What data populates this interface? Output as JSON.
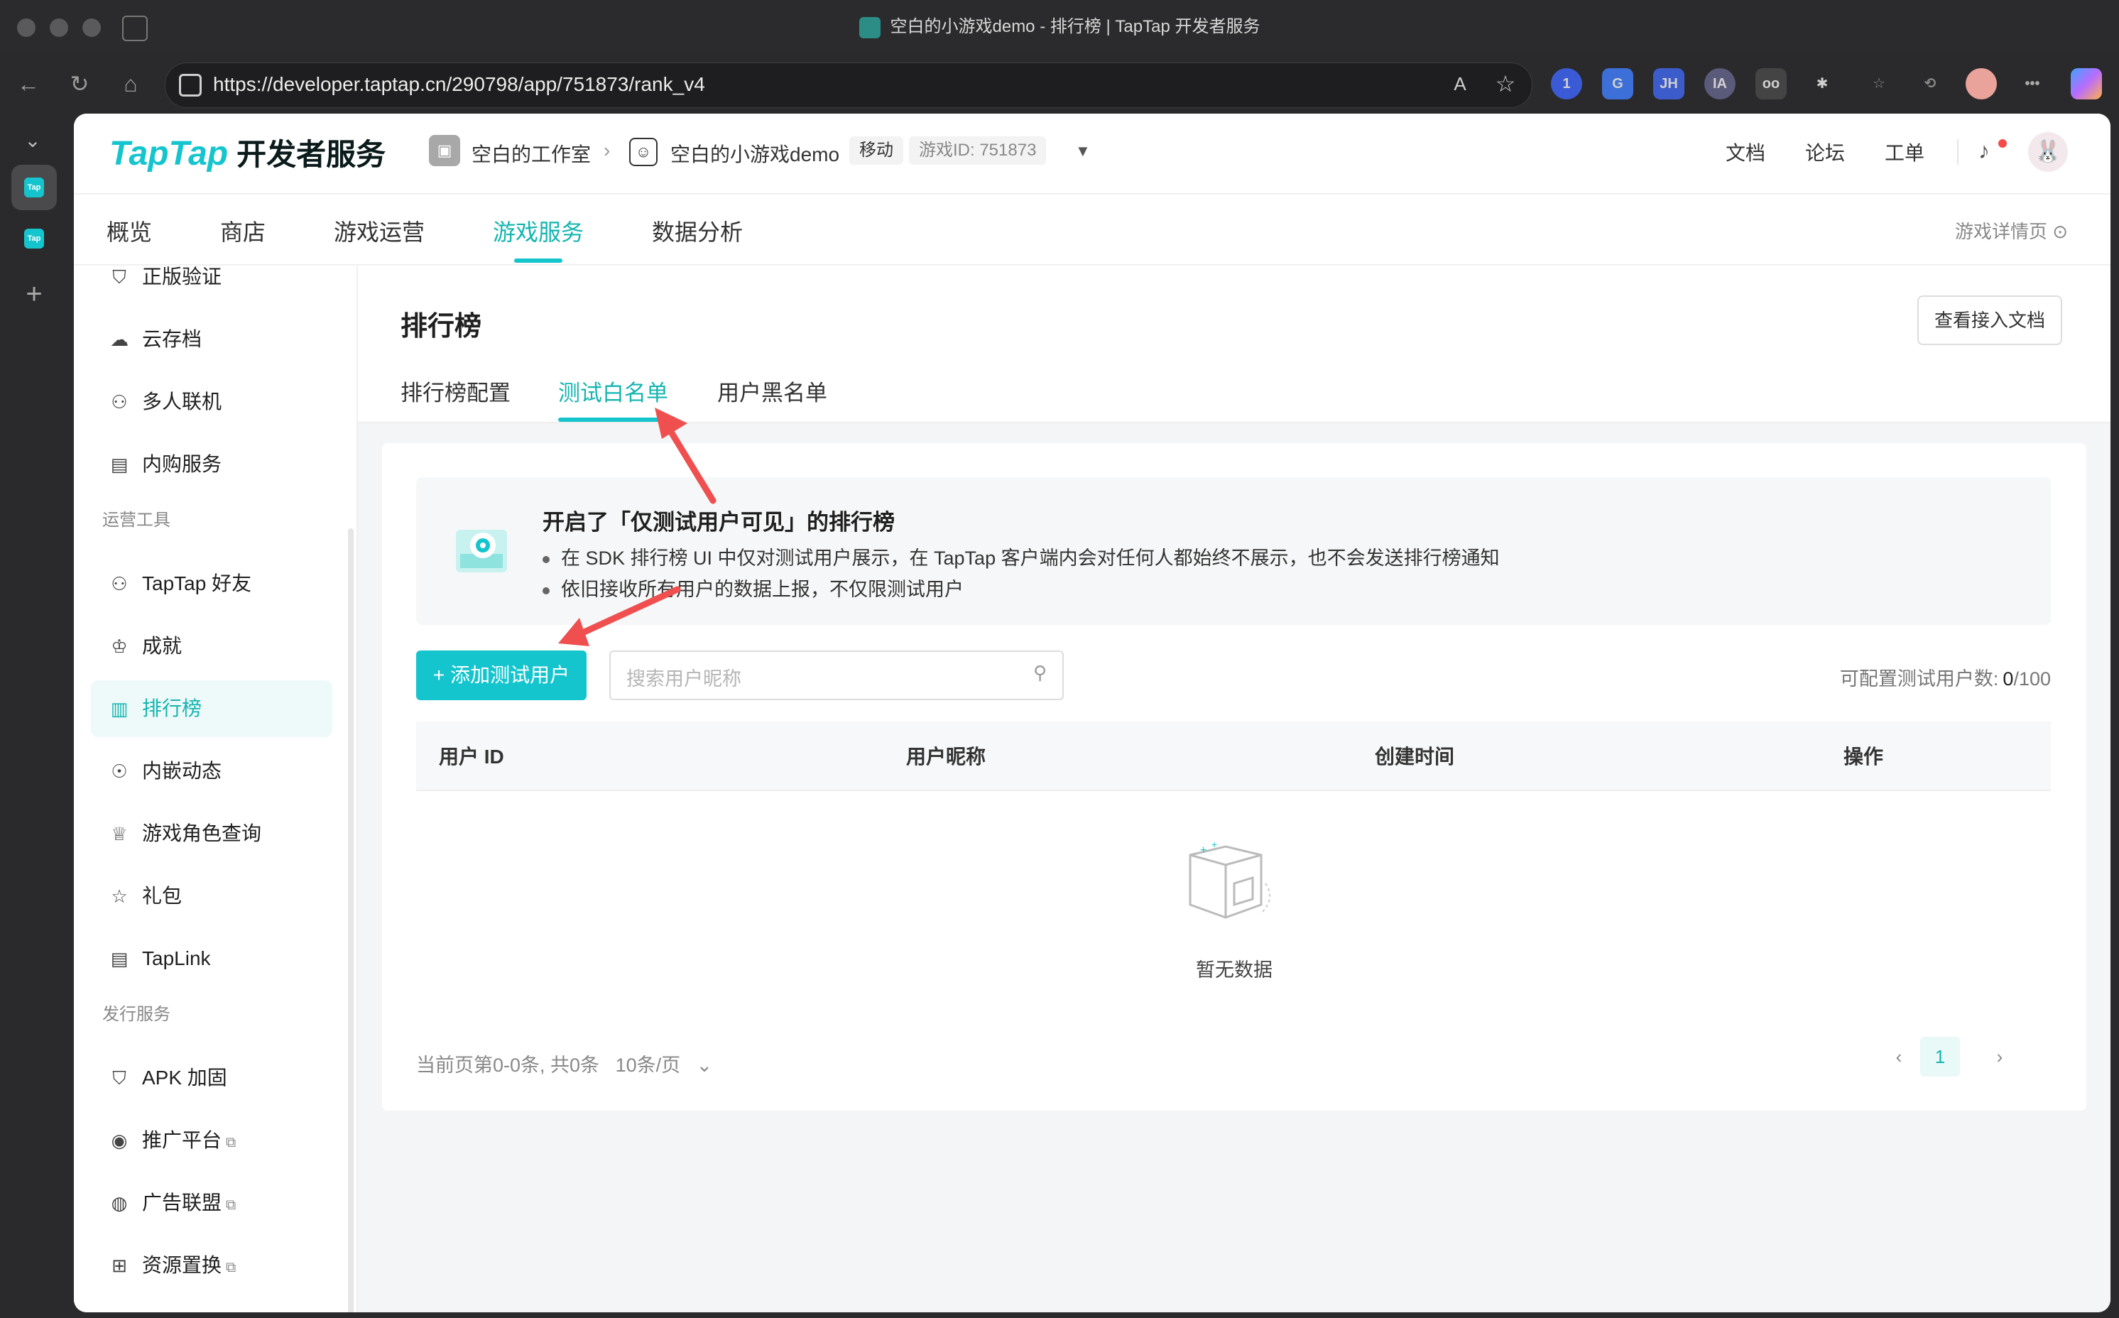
{
  "browser": {
    "window_title": "空白的小游戏demo - 排行榜 | TapTap 开发者服务",
    "url": "https://developer.taptap.cn/290798/app/751873/rank_v4",
    "extensions": [
      "1",
      "G",
      "JH",
      "IA",
      "oo",
      "✱",
      "☆",
      "⟲",
      "•••"
    ]
  },
  "header": {
    "logo_brand": "TapTap",
    "logo_cn": "开发者服务",
    "studio": "空白的工作室",
    "game": "空白的小游戏demo",
    "platform_tag": "移动",
    "game_id": "游戏ID: 751873",
    "links": [
      "文档",
      "论坛",
      "工单"
    ]
  },
  "main_tabs": [
    "概览",
    "商店",
    "游戏运营",
    "游戏服务",
    "数据分析"
  ],
  "main_tab_active": "游戏服务",
  "detail_link": "游戏详情页",
  "sidebar": {
    "items_top": [
      "正版验证",
      "云存档",
      "多人联机",
      "内购服务"
    ],
    "group_ops": "运营工具",
    "items_ops": [
      "TapTap 好友",
      "成就",
      "排行榜",
      "内嵌动态",
      "游戏角色查询",
      "礼包",
      "TapLink"
    ],
    "group_pub": "发行服务",
    "items_pub": [
      "APK 加固",
      "推广平台",
      "广告联盟",
      "资源置换"
    ]
  },
  "content": {
    "title": "排行榜",
    "doc_button": "查看接入文档",
    "sub_tabs": [
      "排行榜配置",
      "测试白名单",
      "用户黑名单"
    ],
    "notice": {
      "title": "开启了「仅测试用户可见」的排行榜",
      "line1": "在 SDK 排行榜 UI 中仅对测试用户展示，在 TapTap 客户端内会对任何人都始终不展示，也不会发送排行榜通知",
      "line2": "依旧接收所有用户的数据上报，不仅限测试用户"
    },
    "add_button": "添加测试用户",
    "search_placeholder": "搜索用户昵称",
    "quota_label": "可配置测试用户数:",
    "quota_current": "0",
    "quota_total": "/100",
    "table_headers": [
      "用户 ID",
      "用户昵称",
      "创建时间",
      "操作"
    ],
    "empty_text": "暂无数据",
    "pager_text": "当前页第0-0条, 共0条",
    "page_size": "10条/页",
    "current_page": "1"
  },
  "colors": {
    "accent": "#15c5ce",
    "accent_text": "#15b5b0",
    "annotation_arrow": "#ef4f4f"
  }
}
